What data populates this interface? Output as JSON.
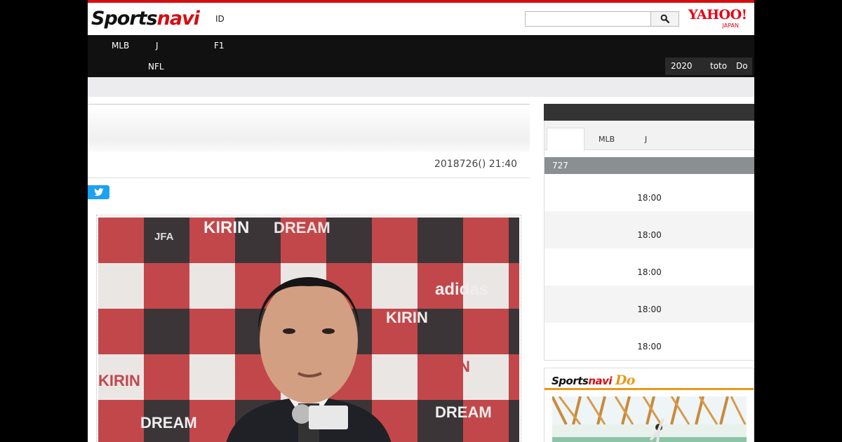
{
  "header": {
    "logo_sports": "Sports",
    "logo_navi": "navi",
    "id_link": "ID",
    "search_value": "",
    "yahoo_logo": "YAHOO!",
    "yahoo_sub": "JAPAN"
  },
  "nav": {
    "row1": [
      "MLB",
      "J",
      "F1"
    ],
    "row2": [
      "NFL"
    ],
    "right": [
      "2020",
      "toto",
      "Do"
    ]
  },
  "article": {
    "date": "2018726() 21:40",
    "photo_alt_banner": [
      "KIRIN",
      "DREAM",
      "adidas",
      "JFA"
    ]
  },
  "sidebar": {
    "tabs": [
      "MLB",
      "J"
    ],
    "date_label": "727",
    "schedule_times": [
      "18:00",
      "18:00",
      "18:00",
      "18:00",
      "18:00"
    ]
  },
  "do_box": {
    "logo_sports": "Sports",
    "logo_navi": "navi",
    "logo_do": "Do"
  },
  "colors": {
    "brand_red": "#d50e10",
    "nav_bg": "#111111",
    "twitter": "#1da1f2",
    "date_bar": "#8a9092",
    "do_orange": "#e89a1a"
  }
}
